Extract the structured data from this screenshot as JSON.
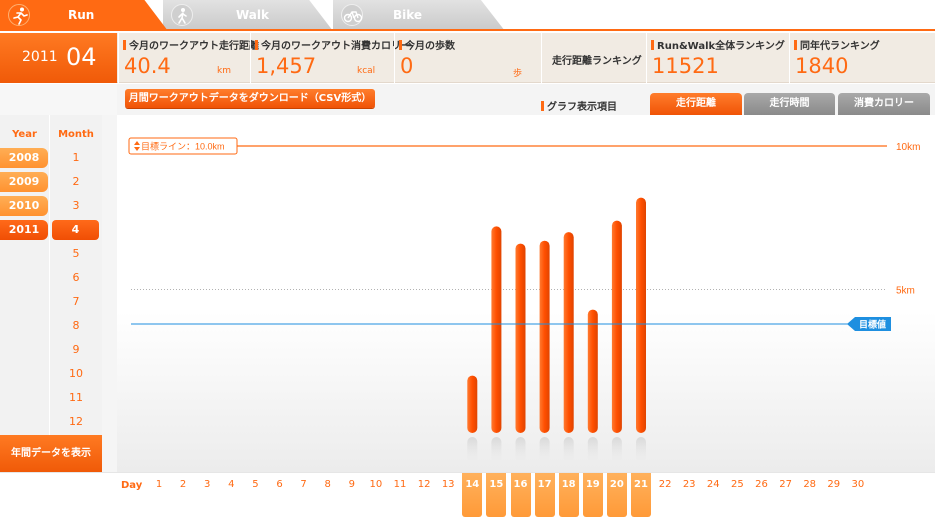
{
  "tabs": [
    {
      "label": "Run",
      "active": true,
      "icon": "runner-icon"
    },
    {
      "label": "Walk",
      "active": false,
      "icon": "walker-icon"
    },
    {
      "label": "Bike",
      "active": false,
      "icon": "bicycle-icon"
    }
  ],
  "period": {
    "year": "2011",
    "month": "04"
  },
  "stats": {
    "distance": {
      "title": "今月のワークアウト走行距離",
      "value": "40.4",
      "unit": "km"
    },
    "calories": {
      "title": "今月のワークアウト消費カロリー",
      "value": "1,457",
      "unit": "kcal"
    },
    "steps": {
      "title": "今月の歩数",
      "value": "0",
      "unit": "歩"
    },
    "ranking_label": "走行距離ランキング",
    "overall_rank": {
      "title": "Run&Walk全体ランキング",
      "value": "11521"
    },
    "age_rank": {
      "title": "同年代ランキング",
      "value": "1840"
    }
  },
  "toolbar": {
    "csv_button": "月間ワークアウトデータをダウンロード（CSV形式）",
    "graph_label": "グラフ表示項目",
    "graph_options": [
      "走行距離",
      "走行時間",
      "消費カロリー"
    ],
    "graph_active": 0
  },
  "sidebar": {
    "year_header": "Year",
    "month_header": "Month",
    "years": [
      "2008",
      "2009",
      "2010",
      "2011"
    ],
    "active_year": "2011",
    "months": [
      "1",
      "2",
      "3",
      "4",
      "5",
      "6",
      "7",
      "8",
      "9",
      "10",
      "11",
      "12"
    ],
    "active_month": "4",
    "annual_button": "年間データを表示"
  },
  "chart_data": {
    "type": "bar",
    "day_axis_label": "Day",
    "days": [
      1,
      2,
      3,
      4,
      5,
      6,
      7,
      8,
      9,
      10,
      11,
      12,
      13,
      14,
      15,
      16,
      17,
      18,
      19,
      20,
      21,
      22,
      23,
      24,
      25,
      26,
      27,
      28,
      29,
      30
    ],
    "workout_days": [
      14,
      15,
      16,
      17,
      18,
      19,
      20,
      21
    ],
    "values": [
      2.0,
      7.2,
      6.6,
      6.7,
      7.0,
      4.3,
      7.4,
      8.2
    ],
    "goal_line": {
      "label": "目標ライン：10.0km",
      "value": 10.0,
      "tick": "10km"
    },
    "mid_tick": {
      "value": 5.0,
      "label": "5km"
    },
    "target_value": {
      "label": "目標値",
      "value": 3.8
    },
    "colors": {
      "bar": "#ff5a0a",
      "goal": "#ff6a13",
      "target": "#1e8fe0"
    }
  }
}
